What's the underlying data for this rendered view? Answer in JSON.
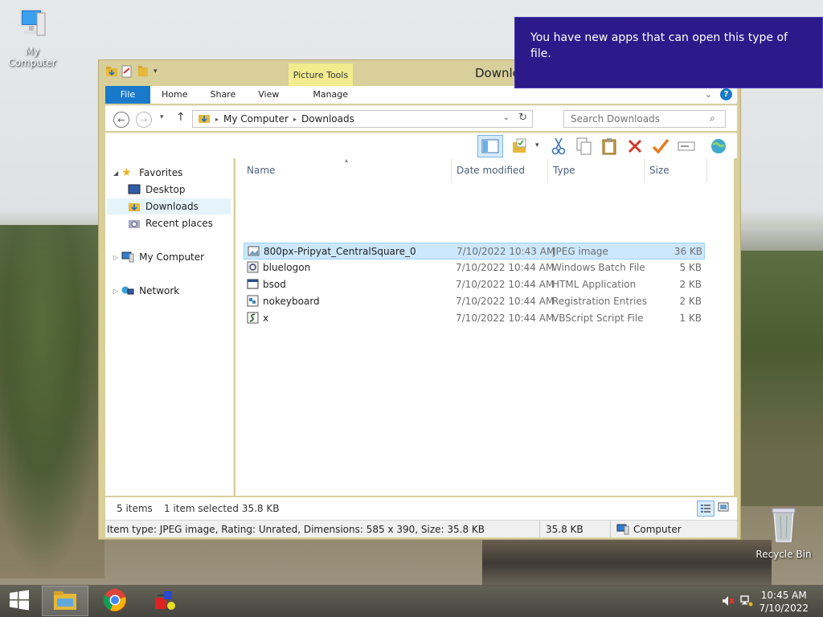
{
  "desktop": {
    "icons": [
      {
        "label": "My Computer"
      },
      {
        "label": "Recycle Bin"
      }
    ]
  },
  "window": {
    "title": "Downlo",
    "context_tab": "Picture Tools",
    "ribbon_tabs": [
      "File",
      "Home",
      "Share",
      "View",
      "Manage"
    ],
    "breadcrumb": [
      "My Computer",
      "Downloads"
    ],
    "search_placeholder": "Search Downloads",
    "nav": {
      "favorites": "Favorites",
      "desktop": "Desktop",
      "downloads": "Downloads",
      "recent": "Recent places",
      "my_computer": "My Computer",
      "network": "Network"
    },
    "columns": {
      "name": "Name",
      "date": "Date modified",
      "type": "Type",
      "size": "Size"
    },
    "files": [
      {
        "name": "800px-Pripyat_CentralSquare_0",
        "date": "7/10/2022 10:43 AM",
        "type": "JPEG image",
        "size": "36 KB",
        "icon": "image-file-icon",
        "selected": true
      },
      {
        "name": "bluelogon",
        "date": "7/10/2022 10:44 AM",
        "type": "Windows Batch File",
        "size": "5 KB",
        "icon": "batch-file-icon"
      },
      {
        "name": "bsod",
        "date": "7/10/2022 10:44 AM",
        "type": "HTML Application",
        "size": "2 KB",
        "icon": "hta-file-icon"
      },
      {
        "name": "nokeyboard",
        "date": "7/10/2022 10:44 AM",
        "type": "Registration Entries",
        "size": "2 KB",
        "icon": "registry-file-icon"
      },
      {
        "name": "x",
        "date": "7/10/2022 10:44 AM",
        "type": "VBScript Script File",
        "size": "1 KB",
        "icon": "script-file-icon"
      }
    ],
    "status": {
      "items": "5 items",
      "selected": "1 item selected  35.8 KB",
      "details": "Item type: JPEG image, Rating: Unrated, Dimensions: 585 x 390, Size: 35.8 KB",
      "size": "35.8 KB",
      "location": "Computer"
    }
  },
  "toast": {
    "message": "You have new apps that can open this type of file."
  },
  "taskbar": {
    "time": "10:45 AM",
    "date": "7/10/2022"
  }
}
